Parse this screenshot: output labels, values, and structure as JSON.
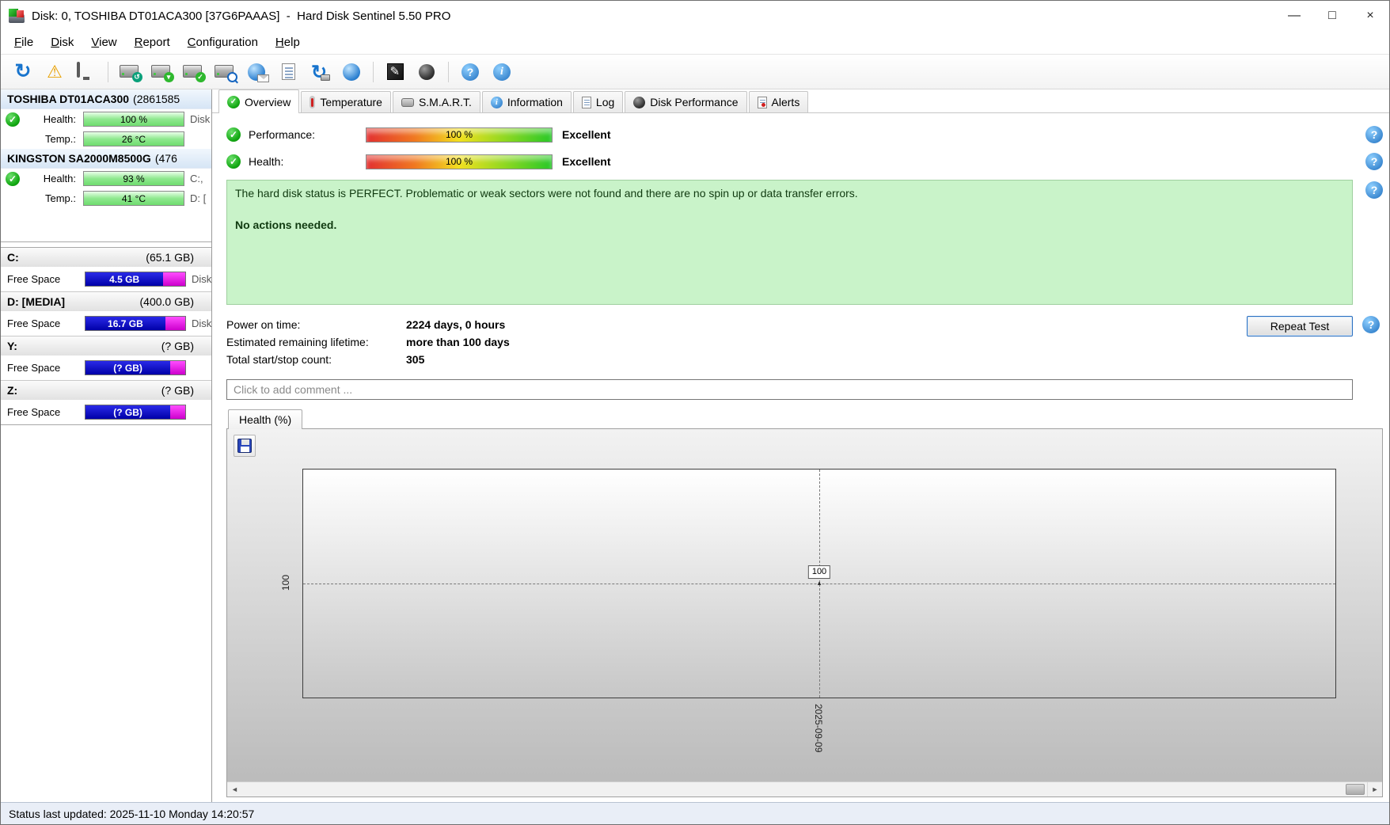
{
  "window": {
    "title": "Disk: 0, TOSHIBA DT01ACA300 [37G6PAAAS]  -  Hard Disk Sentinel 5.50 PRO",
    "minimize": "—",
    "maximize": "□",
    "close": "×"
  },
  "menubar": {
    "items": [
      {
        "label": "File"
      },
      {
        "label": "Disk"
      },
      {
        "label": "View"
      },
      {
        "label": "Report"
      },
      {
        "label": "Configuration"
      },
      {
        "label": "Help"
      }
    ]
  },
  "toolbar": {
    "icons": [
      "refresh",
      "error-report-warning",
      "desktop-monitor",
      "disk-rescan",
      "disk-test",
      "disk-accept",
      "disk-search",
      "email-report-globe",
      "report-page",
      "sync-disks",
      "network-disk",
      "surface-test-pen",
      "disk-performance-sphere",
      "help",
      "information"
    ]
  },
  "sidebar": {
    "disks": [
      {
        "name": "TOSHIBA DT01ACA300",
        "size": "(2861585",
        "health_label": "Health:",
        "health_value": "100 %",
        "temp_label": "Temp.:",
        "temp_value": "26 °C",
        "right_text_1": "Disk",
        "right_text_2": ""
      },
      {
        "name": "KINGSTON SA2000M8500G",
        "size": "(476",
        "health_label": "Health:",
        "health_value": "93 %",
        "temp_label": "Temp.:",
        "temp_value": "41 °C",
        "right_text_1": "C:,",
        "right_text_2": "D: ["
      }
    ],
    "partitions": [
      {
        "name": "C:",
        "size": "(65.1 GB)",
        "free_label": "Free Space",
        "free_value": "4.5 GB",
        "right_text": "Disk"
      },
      {
        "name": "D: [MEDIA]",
        "size": "(400.0 GB)",
        "free_label": "Free Space",
        "free_value": "16.7 GB",
        "right_text": "Disk"
      },
      {
        "name": "Y:",
        "size": "(? GB)",
        "free_label": "Free Space",
        "free_value": "(? GB)",
        "right_text": ""
      },
      {
        "name": "Z:",
        "size": "(? GB)",
        "free_label": "Free Space",
        "free_value": "(? GB)",
        "right_text": ""
      }
    ]
  },
  "tabs": [
    {
      "label": "Overview",
      "active": true
    },
    {
      "label": "Temperature",
      "active": false
    },
    {
      "label": "S.M.A.R.T.",
      "active": false
    },
    {
      "label": "Information",
      "active": false
    },
    {
      "label": "Log",
      "active": false
    },
    {
      "label": "Disk Performance",
      "active": false
    },
    {
      "label": "Alerts",
      "active": false
    }
  ],
  "overview": {
    "performance": {
      "label": "Performance:",
      "value": "100 %",
      "rating": "Excellent"
    },
    "health": {
      "label": "Health:",
      "value": "100 %",
      "rating": "Excellent"
    },
    "status_message": "The hard disk status is PERFECT. Problematic or weak sectors were not found and there are no spin up or data transfer errors.",
    "status_action": "No actions needed.",
    "stats": [
      {
        "label": "Power on time:",
        "value": "2224 days, 0 hours"
      },
      {
        "label": "Estimated remaining lifetime:",
        "value": "more than 100 days"
      },
      {
        "label": "Total start/stop count:",
        "value": "305"
      }
    ],
    "repeat_test_label": "Repeat Test",
    "comment_placeholder": "Click to add comment ...",
    "chart_tab_label": "Health (%)"
  },
  "chart_data": {
    "type": "line",
    "title": "Health (%)",
    "x": [
      "2025-09-09"
    ],
    "series": [
      {
        "name": "Health",
        "values": [
          100
        ]
      }
    ],
    "point_labels": [
      "100"
    ],
    "yticks": [
      "100"
    ],
    "xlabel": "",
    "ylabel": "",
    "grid": "dashed-crosshair-at-point",
    "legend_position": "none"
  },
  "statusbar": {
    "text": "Status last updated: 2025-11-10 Monday 14:20:57"
  },
  "colors": {
    "health_bar_green": "#8fe88f",
    "free_space_blue": "#0000a8",
    "free_space_magenta": "#e600e6",
    "status_box_green": "#c9f3c9",
    "gauge_gradient_left": "#e23030",
    "gauge_gradient_mid": "#f2e020",
    "gauge_gradient_right": "#28c828",
    "statusbar_bg": "#e9eef7"
  }
}
